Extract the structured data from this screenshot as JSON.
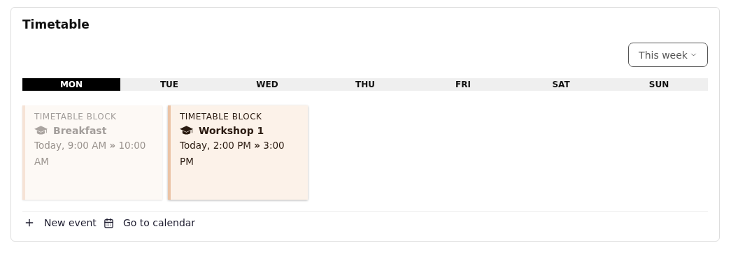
{
  "title": "Timetable",
  "range_select": {
    "value": "This week"
  },
  "days": [
    {
      "label": "MON",
      "selected": true
    },
    {
      "label": "TUE",
      "selected": false
    },
    {
      "label": "WED",
      "selected": false
    },
    {
      "label": "THU",
      "selected": false
    },
    {
      "label": "FRI",
      "selected": false
    },
    {
      "label": "SAT",
      "selected": false
    },
    {
      "label": "SUN",
      "selected": false
    }
  ],
  "events": [
    {
      "category": "TIMETABLE BLOCK",
      "name": "Breakfast",
      "time": "Today, 9:00 AM **»** 10:00 AM",
      "past": true
    },
    {
      "category": "TIMETABLE BLOCK",
      "name": "Workshop 1",
      "time": "Today, 2:00 PM **»** 3:00 PM",
      "past": false
    }
  ],
  "footer": {
    "new_event": "New event",
    "go_to_calendar": "Go to calendar"
  }
}
